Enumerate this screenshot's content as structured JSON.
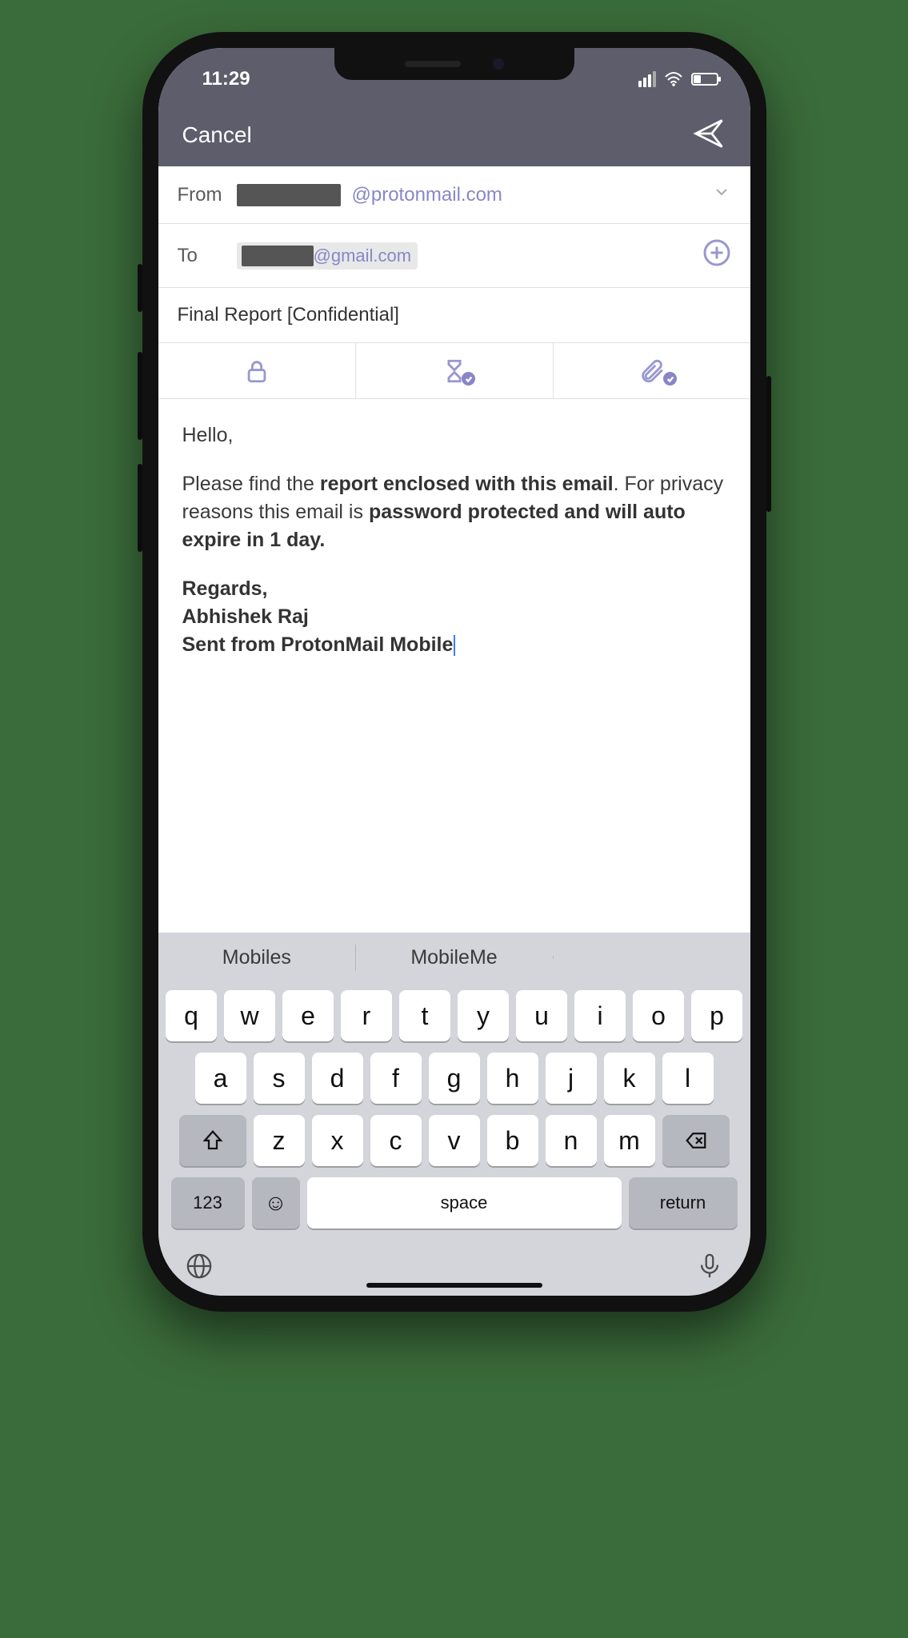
{
  "status": {
    "time": "11:29"
  },
  "nav": {
    "cancel": "Cancel"
  },
  "from": {
    "label": "From",
    "domain": "@protonmail.com"
  },
  "to": {
    "label": "To",
    "domain": "@gmail.com"
  },
  "subject": "Final Report [Confidential]",
  "body": {
    "greeting": "Hello,",
    "line1_pre": "Please find the ",
    "line1_bold": "report enclosed with this email",
    "line1_post": ". For privacy reasons this email is ",
    "line2_bold": "password protected and will auto expire in 1 day.",
    "regards": "Regards,",
    "name": "Abhishek Raj",
    "signature": "Sent from ProtonMail Mobile"
  },
  "suggestions": [
    "Mobiles",
    "MobileMe",
    ""
  ],
  "keyboard": {
    "row1": [
      "q",
      "w",
      "e",
      "r",
      "t",
      "y",
      "u",
      "i",
      "o",
      "p"
    ],
    "row2": [
      "a",
      "s",
      "d",
      "f",
      "g",
      "h",
      "j",
      "k",
      "l"
    ],
    "row3": [
      "z",
      "x",
      "c",
      "v",
      "b",
      "n",
      "m"
    ],
    "num": "123",
    "space": "space",
    "return": "return"
  }
}
